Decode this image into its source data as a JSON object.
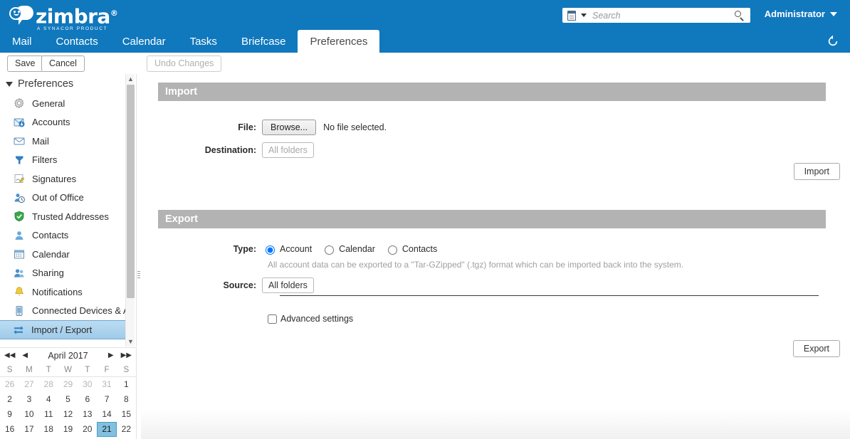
{
  "header": {
    "brand_name": "zimbra",
    "brand_tm": "®",
    "brand_tagline": "A SYNACOR PRODUCT",
    "brand_color": "#1078bd",
    "search": {
      "placeholder": "Search",
      "value": "",
      "type_icon": "document-icon",
      "dropdown_icon": "chevron-down-icon",
      "submit_icon": "search-icon"
    },
    "account_label": "Administrator",
    "account_caret_icon": "chevron-down-icon",
    "refresh_icon": "refresh-icon"
  },
  "tabs": [
    {
      "label": "Mail",
      "active": false
    },
    {
      "label": "Contacts",
      "active": false
    },
    {
      "label": "Calendar",
      "active": false
    },
    {
      "label": "Tasks",
      "active": false
    },
    {
      "label": "Briefcase",
      "active": false
    },
    {
      "label": "Preferences",
      "active": true
    }
  ],
  "toolbar": {
    "save_label": "Save",
    "cancel_label": "Cancel",
    "undo_label": "Undo Changes",
    "undo_disabled": true
  },
  "sidebar": {
    "title": "Preferences",
    "expander_icon": "triangle-down-icon",
    "items": [
      {
        "label": "General",
        "icon": "gear-icon",
        "selected": false
      },
      {
        "label": "Accounts",
        "icon": "accounts-icon",
        "selected": false
      },
      {
        "label": "Mail",
        "icon": "envelope-icon",
        "selected": false
      },
      {
        "label": "Filters",
        "icon": "filter-icon",
        "selected": false
      },
      {
        "label": "Signatures",
        "icon": "signature-icon",
        "selected": false
      },
      {
        "label": "Out of Office",
        "icon": "out-of-office-icon",
        "selected": false
      },
      {
        "label": "Trusted Addresses",
        "icon": "shield-icon",
        "selected": false
      },
      {
        "label": "Contacts",
        "icon": "contact-icon",
        "selected": false
      },
      {
        "label": "Calendar",
        "icon": "calendar-icon",
        "selected": false
      },
      {
        "label": "Sharing",
        "icon": "sharing-icon",
        "selected": false
      },
      {
        "label": "Notifications",
        "icon": "bell-icon",
        "selected": false
      },
      {
        "label": "Connected Devices & Ap",
        "icon": "device-icon",
        "selected": false
      },
      {
        "label": "Import / Export",
        "icon": "import-export-icon",
        "selected": true
      }
    ],
    "scrollbar": {
      "up_arrow_icon": "chevron-up-icon",
      "down_arrow_icon": "chevron-down-icon"
    }
  },
  "mini_calendar": {
    "title": "April 2017",
    "nav": {
      "prev_year_icon": "double-chevron-left-icon",
      "prev_month_icon": "chevron-left-icon",
      "next_month_icon": "chevron-right-icon",
      "next_year_icon": "double-chevron-right-icon"
    },
    "day_headers": [
      "S",
      "M",
      "T",
      "W",
      "T",
      "F",
      "S"
    ],
    "weeks": [
      [
        {
          "d": "26",
          "other": true
        },
        {
          "d": "27",
          "other": true
        },
        {
          "d": "28",
          "other": true
        },
        {
          "d": "29",
          "other": true
        },
        {
          "d": "30",
          "other": true
        },
        {
          "d": "31",
          "other": true
        },
        {
          "d": "1",
          "other": false
        }
      ],
      [
        {
          "d": "2"
        },
        {
          "d": "3"
        },
        {
          "d": "4"
        },
        {
          "d": "5"
        },
        {
          "d": "6"
        },
        {
          "d": "7"
        },
        {
          "d": "8"
        }
      ],
      [
        {
          "d": "9"
        },
        {
          "d": "10"
        },
        {
          "d": "11"
        },
        {
          "d": "12"
        },
        {
          "d": "13"
        },
        {
          "d": "14"
        },
        {
          "d": "15"
        }
      ],
      [
        {
          "d": "16"
        },
        {
          "d": "17"
        },
        {
          "d": "18"
        },
        {
          "d": "19"
        },
        {
          "d": "20"
        },
        {
          "d": "21",
          "today": true
        },
        {
          "d": "22"
        }
      ]
    ],
    "selected_day": "21"
  },
  "import_section": {
    "heading": "Import",
    "file_label": "File:",
    "browse_label": "Browse...",
    "file_status": "No file selected.",
    "destination_label": "Destination:",
    "destination_value": "All folders",
    "import_button": "Import"
  },
  "export_section": {
    "heading": "Export",
    "type_label": "Type:",
    "type_options": [
      {
        "label": "Account",
        "checked": true
      },
      {
        "label": "Calendar",
        "checked": false
      },
      {
        "label": "Contacts",
        "checked": false
      }
    ],
    "hint": "All account data can be exported to a \"Tar-GZipped\" (.tgz) format which can be imported back into the system.",
    "source_label": "Source:",
    "source_value": "All folders",
    "advanced_label": "Advanced settings",
    "advanced_checked": false,
    "export_button": "Export"
  }
}
